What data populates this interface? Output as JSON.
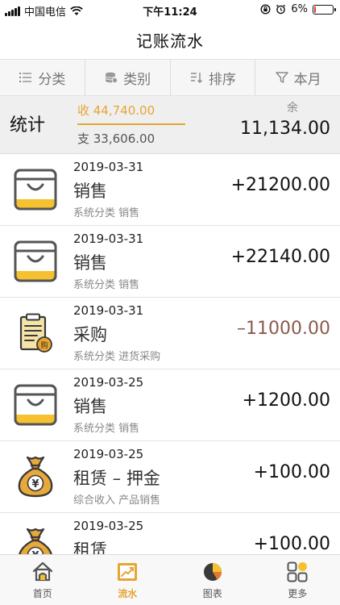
{
  "status_bar": {
    "carrier": "中国电信",
    "time": "下午11:24",
    "battery_text": "6%",
    "battery_level": 0.06
  },
  "nav": {
    "title": "记账流水"
  },
  "filters": [
    {
      "label": "分类",
      "icon": "list-icon"
    },
    {
      "label": "类别",
      "icon": "coins-icon"
    },
    {
      "label": "排序",
      "icon": "sort-icon"
    },
    {
      "label": "本月",
      "icon": "filter-icon"
    }
  ],
  "summary": {
    "label": "统计",
    "income": "收 44,740.00",
    "expense": "支 33,606.00",
    "balance_label": "余",
    "balance": "11,134.00"
  },
  "records": [
    {
      "date": "2019-03-31",
      "name": "销售",
      "category": "系统分类 销售",
      "amount": "+21200.00",
      "icon": "shopping-bag-icon",
      "negative": false
    },
    {
      "date": "2019-03-31",
      "name": "销售",
      "category": "系统分类 销售",
      "amount": "+22140.00",
      "icon": "shopping-bag-icon",
      "negative": false
    },
    {
      "date": "2019-03-31",
      "name": "采购",
      "category": "系统分类 进货采购",
      "amount": "–11000.00",
      "icon": "purchase-clipboard-icon",
      "negative": true
    },
    {
      "date": "2019-03-25",
      "name": "销售",
      "category": "系统分类 销售",
      "amount": "+1200.00",
      "icon": "shopping-bag-icon",
      "negative": false
    },
    {
      "date": "2019-03-25",
      "name": "租赁 – 押金",
      "category": "综合收入 产品销售",
      "amount": "+100.00",
      "icon": "money-bag-icon",
      "negative": false
    },
    {
      "date": "2019-03-25",
      "name": "租赁",
      "category": "",
      "amount": "+100.00",
      "icon": "money-bag-icon",
      "negative": false
    }
  ],
  "tabs": [
    {
      "label": "首页",
      "icon": "home-icon",
      "active": false
    },
    {
      "label": "流水",
      "icon": "trend-chart-icon",
      "active": true
    },
    {
      "label": "图表",
      "icon": "pie-chart-icon",
      "active": false
    },
    {
      "label": "更多",
      "icon": "more-grid-icon",
      "active": false
    }
  ],
  "colors": {
    "accent": "#e6a532",
    "negative": "#8a5a4d",
    "battery_low": "#e23b2e"
  }
}
